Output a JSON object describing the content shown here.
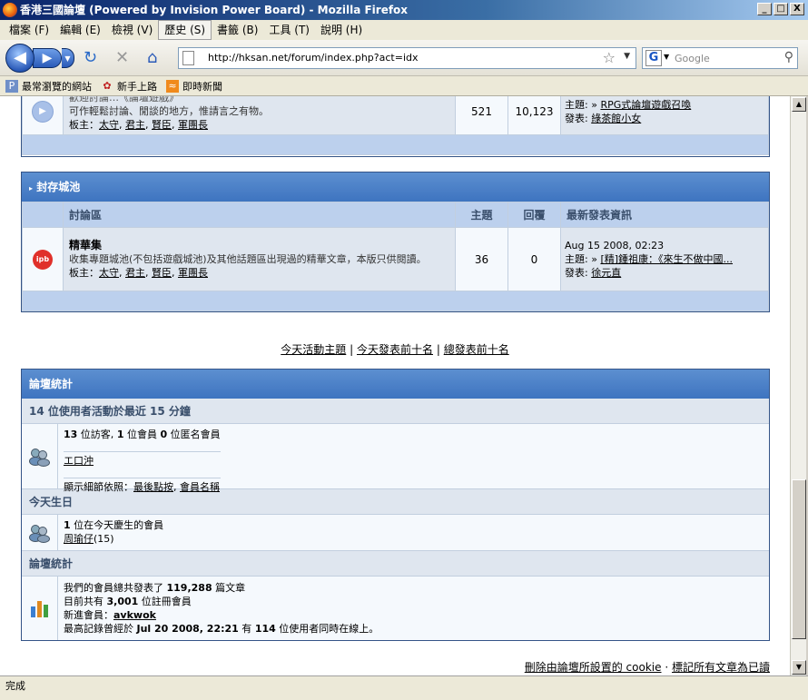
{
  "window": {
    "title": "香港三國論壇 (Powered by Invision Power Board) - Mozilla Firefox",
    "controls": [
      "_",
      "□",
      "X"
    ]
  },
  "menu": [
    "檔案 (F)",
    "編輯 (E)",
    "檢視 (V)",
    "歷史 (S)",
    "書籤 (B)",
    "工具 (T)",
    "說明 (H)"
  ],
  "nav": {
    "url": "http://hksan.net/forum/index.php?act=idx",
    "search_placeholder": "Google"
  },
  "bookmarks": [
    "最常瀏覽的網站",
    "新手上路",
    "即時新聞"
  ],
  "top_forum": {
    "desc_partial": "歡迎討論…《論壇遊戲》",
    "desc_line2": "可作輕鬆討論、閒談的地方，惟請言之有物。",
    "mods_label": "板主：",
    "mods": [
      "太守",
      "君主",
      "賢臣",
      "軍團長"
    ],
    "topics": "521",
    "replies": "10,123",
    "last_topic_label": "主題: »",
    "last_topic": "RPG式論壇遊戲召喚",
    "last_poster_label": "發表:",
    "last_poster": "綠茶館小女"
  },
  "archive": {
    "category": "封存城池",
    "columns": [
      "討論區",
      "主題",
      "回覆",
      "最新發表資訊"
    ],
    "forum": {
      "icon_text": "ipb",
      "name": "精華集",
      "desc": "收集專題城池(不包括遊戲城池)及其他話題區出現過的精華文章，本版只供閱讀。",
      "mods_label": "板主：",
      "mods": [
        "太守",
        "君主",
        "賢臣",
        "軍團長"
      ],
      "topics": "36",
      "replies": "0",
      "last_date": "Aug 15 2008, 02:23",
      "last_topic_label": "主題: »",
      "last_topic": "[精]鍾祖康：《來生不做中國...",
      "last_poster_label": "發表:",
      "last_poster": "徐元直"
    }
  },
  "links": {
    "today_active": "今天活動主題",
    "sep": "|",
    "today_top10": "今天發表前十名",
    "total_top10": "總發表前十名"
  },
  "stats": {
    "title": "論壇統計",
    "active_header": "14 位使用者活動於最近 15 分鐘",
    "active_line": [
      "13",
      " 位訪客, ",
      "1",
      " 位會員 ",
      "0",
      " 位匿名會員"
    ],
    "active_user": "エ口沖",
    "display_by_label": "顯示細節依照：",
    "display_by_last": "最後點按",
    "display_by_name": "會員名稱",
    "birthday_header": "今天生日",
    "birthday_line": [
      "1",
      " 位在今天慶生的會員"
    ],
    "birthday_user": "周瑜仔",
    "birthday_age": "(15)",
    "board_header": "論壇統計",
    "posts_line": [
      "我們的會員總共發表了 ",
      "119,288",
      " 篇文章"
    ],
    "members_line": [
      "目前共有 ",
      "3,001",
      " 位註冊會員"
    ],
    "newest_label": "新進會員：",
    "newest_member": "avkwok",
    "record_line": [
      "最高記錄曾經於 ",
      "Jul 20 2008, 22:21",
      " 有 ",
      "114",
      " 位使用者同時在線上。"
    ]
  },
  "footer": {
    "delete_cookies": "刪除由論壇所設置的 cookie",
    "dot": "·",
    "mark_read": "標記所有文章為已讀"
  },
  "status": "完成"
}
